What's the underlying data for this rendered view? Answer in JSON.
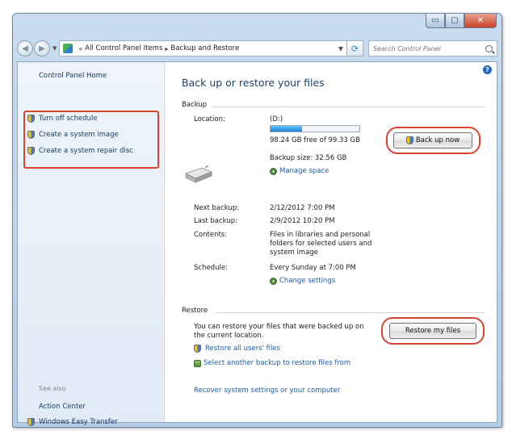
{
  "window": {
    "caption": {
      "minimize": "▭",
      "maximize": "▢",
      "close": "✕"
    }
  },
  "navbar": {
    "breadcrumb": [
      "All Control Panel Items",
      "Backup and Restore"
    ],
    "search_placeholder": "Search Control Panel"
  },
  "sidebar": {
    "home_link": "Control Panel Home",
    "tasks": [
      {
        "label": "Turn off schedule",
        "icon": "shield-icon"
      },
      {
        "label": "Create a system image",
        "icon": "shield-icon"
      },
      {
        "label": "Create a system repair disc",
        "icon": "shield-icon"
      }
    ],
    "see_also_heading": "See also",
    "see_also": [
      {
        "label": "Action Center"
      },
      {
        "label": "Windows Easy Transfer",
        "icon": "shield-icon"
      }
    ]
  },
  "main": {
    "title": "Back up or restore your files",
    "backup": {
      "heading": "Backup",
      "location_label": "Location:",
      "drive": "(D:)",
      "usage_fraction": 0.35,
      "free_space": "98.24 GB free of 99.33 GB",
      "backup_size": "Backup size: 32.56 GB",
      "manage_space": "Manage space",
      "back_up_now": "Back up now",
      "next_backup_label": "Next backup:",
      "next_backup": "2/12/2012 7:00 PM",
      "last_backup_label": "Last backup:",
      "last_backup": "2/9/2012 10:20 PM",
      "contents_label": "Contents:",
      "contents": [
        "Files in libraries and personal",
        "folders for selected users and",
        "system image"
      ],
      "schedule_label": "Schedule:",
      "schedule": "Every Sunday at 7:00 PM",
      "change_settings": "Change settings"
    },
    "restore": {
      "heading": "Restore",
      "text": [
        "You can restore your files that were backed up on",
        "the current location."
      ],
      "restore_my_files": "Restore my files",
      "restore_all_users": "Restore all users' files",
      "select_another": "Select another backup to restore files from",
      "recover_system": "Recover system settings or your computer"
    }
  }
}
